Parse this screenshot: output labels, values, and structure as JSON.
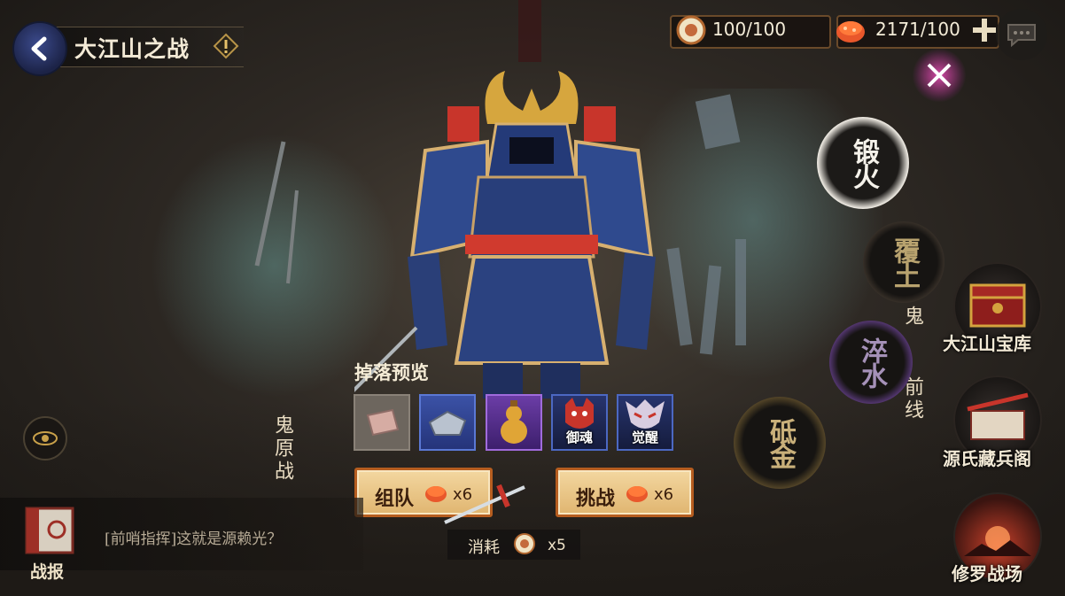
{
  "header": {
    "title": "大江山之战",
    "stamina": "100/100",
    "currency": "2171/100"
  },
  "drop_preview": {
    "label": "掉落预览",
    "items": [
      {
        "name": "material-shard",
        "rarity": "common",
        "label": ""
      },
      {
        "name": "stone-fragment",
        "rarity": "rare",
        "label": ""
      },
      {
        "name": "gold-gourd",
        "rarity": "epic",
        "label": ""
      },
      {
        "name": "soul-mask",
        "rarity": "frame",
        "label": "御魂"
      },
      {
        "name": "awakening-mask",
        "rarity": "frame",
        "label": "觉醒"
      }
    ]
  },
  "actions": {
    "team": {
      "label": "组队",
      "count": "x6"
    },
    "challenge": {
      "label": "挑战",
      "count": "x6"
    }
  },
  "cost": {
    "label": "消耗",
    "count": "x5"
  },
  "report": {
    "label": "战报",
    "message": "[前哨指挥]这就是源赖光？"
  },
  "map_labels": {
    "left": "鬼原战",
    "right_top": "鬼",
    "right_bottom": "前线"
  },
  "elements": [
    {
      "name": "forge",
      "text": "锻火",
      "state": "active"
    },
    {
      "name": "earth",
      "text": "覆土",
      "state": "inactive"
    },
    {
      "name": "water",
      "text": "淬水",
      "state": "inactive"
    },
    {
      "name": "metal",
      "text": "砥金",
      "state": "inactive"
    }
  ],
  "menu": {
    "treasury": "大江山宝库",
    "armory": "源氏藏兵阁",
    "battlefield": "修罗战场"
  },
  "colors": {
    "button_fill": "#e9c68a",
    "button_border": "#b65d1f",
    "rare_blue": "#3b52a6",
    "epic_purple": "#6b3da6"
  }
}
